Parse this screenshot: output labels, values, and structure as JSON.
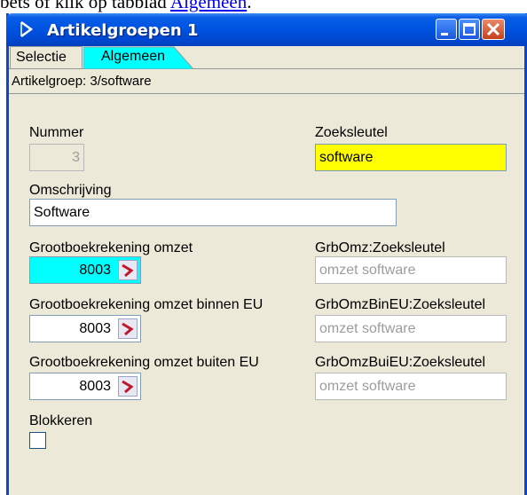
{
  "caption": {
    "before": "bets of klik op tabblad ",
    "link": "Algemeen",
    "after": "."
  },
  "window": {
    "title": "Artikelgroepen 1",
    "title_color": "#0054e3",
    "icons": {
      "app": "app-arrow-icon",
      "min": "minimize-icon",
      "max": "maximize-icon",
      "close": "close-icon"
    }
  },
  "tabs": [
    {
      "label": "Selectie",
      "selected": false
    },
    {
      "label": "Algemeen",
      "selected": true,
      "color": "#00ffff"
    }
  ],
  "info": "Artikelgroep: 3/software",
  "form": {
    "nummer": {
      "label": "Nummer",
      "value": "3"
    },
    "zoeksleutel": {
      "label": "Zoeksleutel",
      "value": "software",
      "bg": "#ffff00"
    },
    "omschrijving": {
      "label": "Omschrijving",
      "value": "Software"
    },
    "gb_omzet": {
      "label": "Grootboekrekening omzet",
      "value": "8003",
      "bg": "#00ffff"
    },
    "gb_omzet_zoek": {
      "label": "GrbOmz:Zoeksleutel",
      "value": "omzet software"
    },
    "gb_binnen": {
      "label": "Grootboekrekening omzet binnen EU",
      "value": "8003"
    },
    "gb_binnen_zoek": {
      "label": "GrbOmzBinEU:Zoeksleutel",
      "value": "omzet software"
    },
    "gb_buiten": {
      "label": "Grootboekrekening omzet buiten EU",
      "value": "8003"
    },
    "gb_buiten_zoek": {
      "label": "GrbOmzBuiEU:Zoeksleutel",
      "value": "omzet software"
    },
    "blokkeren": {
      "label": "Blokkeren",
      "checked": false
    },
    "lookup_icon": "lookup-arrow-icon"
  }
}
